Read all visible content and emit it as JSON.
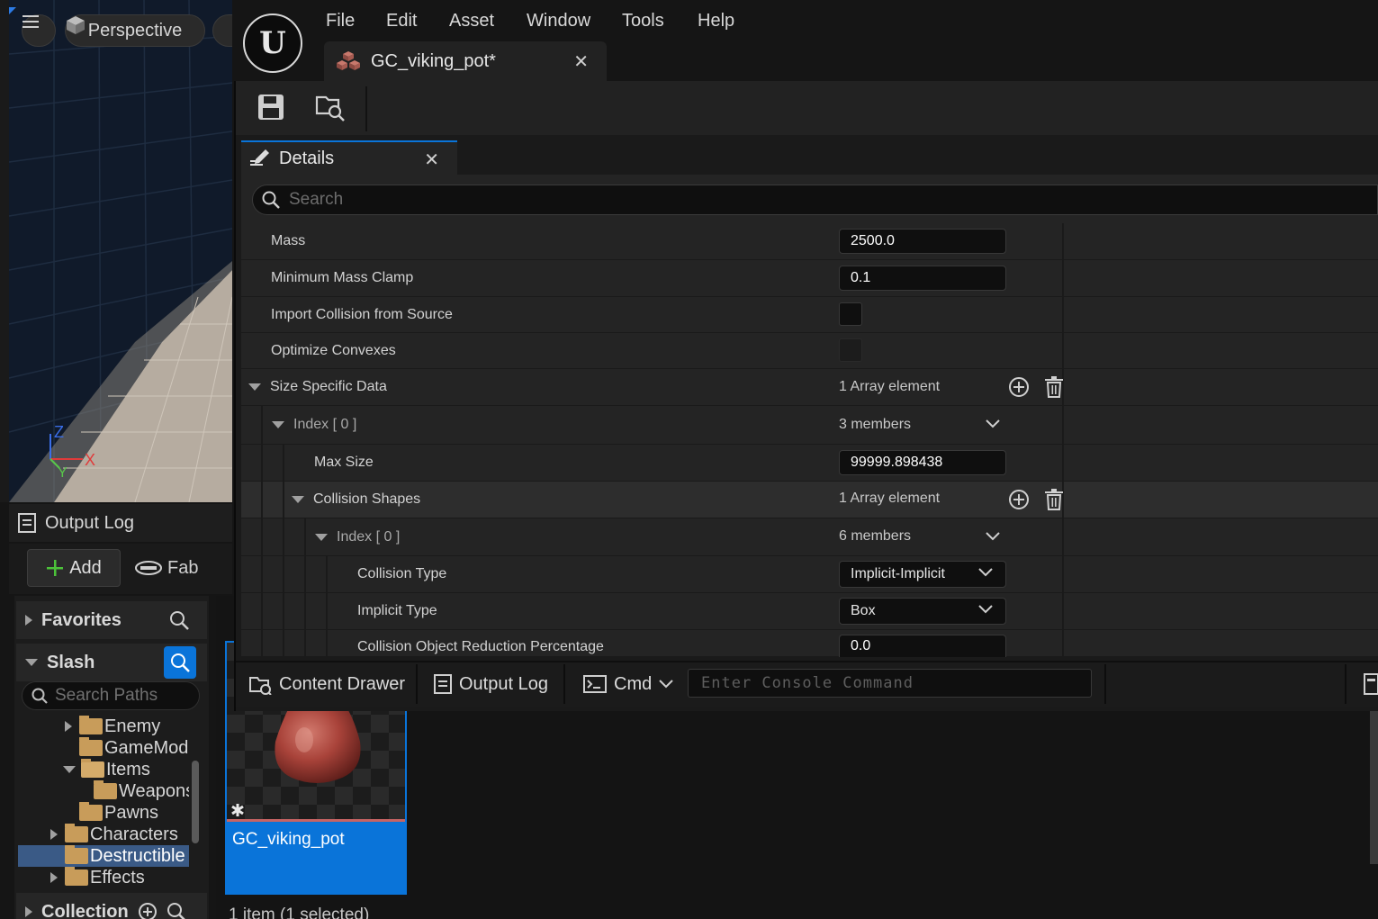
{
  "viewport": {
    "view_mode": "Perspective",
    "gizmo": {
      "z": "Z",
      "x": "X",
      "y": "Y"
    }
  },
  "left_panel": {
    "output_log_label": "Output Log",
    "add_label": "Add",
    "fab_label": "Fab",
    "favorites_label": "Favorites",
    "project_label": "Slash",
    "search_paths_placeholder": "Search Paths",
    "folders": [
      {
        "label": "Enemy",
        "expanded": false
      },
      {
        "label": "GameMode",
        "expanded": null
      },
      {
        "label": "Items",
        "expanded": true
      },
      {
        "label": "Weapons",
        "expanded": null
      },
      {
        "label": "Pawns",
        "expanded": null
      },
      {
        "label": "Characters",
        "expanded": false
      },
      {
        "label": "Destructible",
        "expanded": null,
        "selected": true
      },
      {
        "label": "Effects",
        "expanded": false
      }
    ],
    "collections_label": "Collection"
  },
  "asset_browser": {
    "tile_label": "GC_viking_pot",
    "status": "1 item (1 selected)"
  },
  "editor": {
    "menu": [
      "File",
      "Edit",
      "Asset",
      "Window",
      "Tools",
      "Help"
    ],
    "doc_tab_title": "GC_viking_pot*",
    "details_tab_title": "Details",
    "search_placeholder": "Search",
    "properties": {
      "mass": {
        "label": "Mass",
        "value": "2500.0"
      },
      "min_mass_clamp": {
        "label": "Minimum Mass Clamp",
        "value": "0.1"
      },
      "import_collision": {
        "label": "Import Collision from Source",
        "checked": false
      },
      "optimize_convexes": {
        "label": "Optimize Convexes",
        "checked": false,
        "enabled": false
      },
      "size_specific_data": {
        "label": "Size Specific Data",
        "value": "1 Array element"
      },
      "index0": {
        "label": "Index [ 0 ]",
        "value": "3 members"
      },
      "max_size": {
        "label": "Max Size",
        "value": "99999.898438"
      },
      "collision_shapes": {
        "label": "Collision Shapes",
        "value": "1 Array element"
      },
      "shape_index0": {
        "label": "Index [ 0 ]",
        "value": "6 members"
      },
      "collision_type": {
        "label": "Collision Type",
        "value": "Implicit-Implicit"
      },
      "implicit_type": {
        "label": "Implicit Type",
        "value": "Box"
      },
      "reduction_pct": {
        "label": "Collision Object Reduction Percentage",
        "value": "0.0"
      }
    },
    "bottom_bar": {
      "content_drawer": "Content Drawer",
      "output_log": "Output Log",
      "cmd": "Cmd",
      "console_placeholder": "Enter Console Command"
    }
  },
  "colors": {
    "accent_blue": "#0a74d9",
    "folder": "#c89c5a",
    "panel_bg": "#242424"
  }
}
